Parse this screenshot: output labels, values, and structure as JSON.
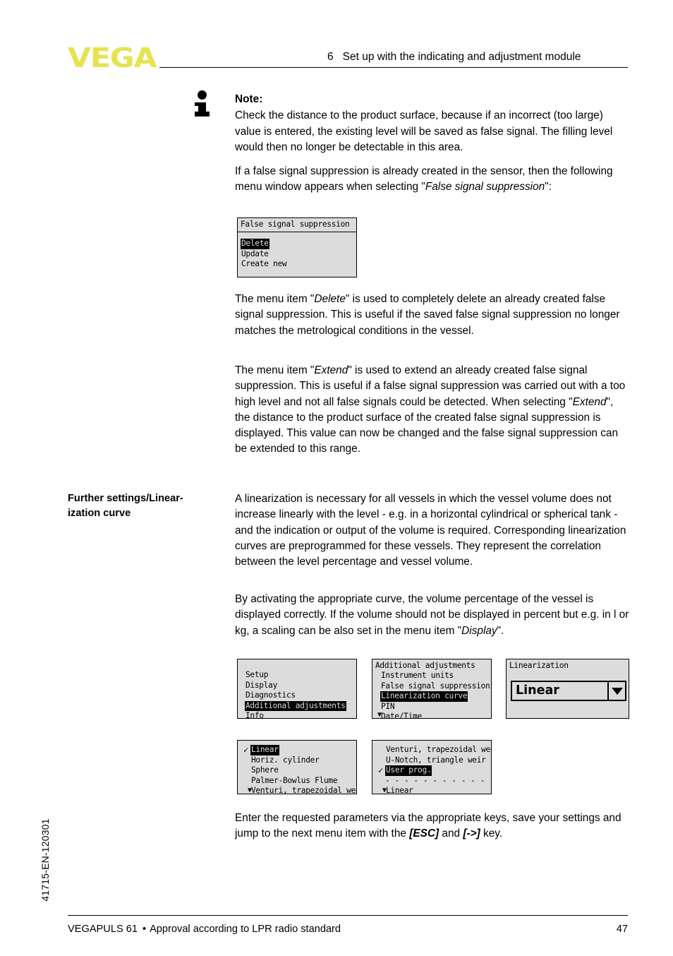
{
  "header": {
    "logo_text": "VEGA",
    "logo_color": "#e6e352",
    "chapter_number": "6",
    "chapter_title": "Set up with the indicating and adjustment module"
  },
  "doc_id": "41715-EN-120301",
  "note": {
    "icon": "info-icon",
    "title": "Note:",
    "text": "Check the distance to the product surface, because if an incorrect (too large) value is entered, the existing level will be saved as false signal. The filling level would then no longer be detectable in this area."
  },
  "paragraphs": {
    "intro_1": "If a false signal suppression is already created in the sensor, then the following menu window appears when selecting \"",
    "intro_1_em": "False signal suppression",
    "intro_1_end": "\":",
    "delete_p_1": "The menu item \"",
    "delete_p_em": "Delete",
    "delete_p_2": "\" is used to completely delete an already created false signal suppression. This is useful if the saved false signal suppression no longer matches the metrological conditions in the vessel.",
    "extend_p_1": "The menu item \"",
    "extend_p_em1": "Extend",
    "extend_p_2": "\" is used to extend an already created false signal suppression. This is useful if a false signal suppression was carried out with a too high level and not all false signals could be detected. When selecting \"",
    "extend_p_em2": "Extend",
    "extend_p_3": "\", the distance to the product surface of the created false signal suppression is displayed. This value can now be changed and the false signal suppression can be extended to this range.",
    "lin_intro": "A linearization is necessary for all vessels in which the vessel volume does not increase linearly with the level - e.g. in a horizontal cylindrical or spherical tank - and the indication or output of the volume is required. Corresponding linearization curves are preprogrammed for these vessels. They represent the correlation between the level percentage and vessel volume.",
    "lin_activate_1": "By activating the appropriate curve, the volume percentage of the vessel is displayed correctly. If the volume should not be displayed in percent but e.g. in l or kg, a scaling can be also set in the menu item \"",
    "lin_activate_em": "Display",
    "lin_activate_2": "\".",
    "closing_1": "Enter the requested parameters via the appropriate keys, save your settings and jump to the next menu item with the ",
    "closing_key1": "[ESC]",
    "closing_mid": " and ",
    "closing_key2": "[->]",
    "closing_2": " key."
  },
  "margin_heading": "Further settings/Linear-\nization curve",
  "lcd_screens": {
    "false_signal": {
      "title": "False signal suppression",
      "items": [
        {
          "label": "Delete",
          "selected": true
        },
        {
          "label": "Update",
          "selected": false
        },
        {
          "label": "Create new",
          "selected": false
        }
      ]
    },
    "main_menu": {
      "items": [
        {
          "label": "Setup",
          "selected": false
        },
        {
          "label": "Display",
          "selected": false
        },
        {
          "label": "Diagnostics",
          "selected": false
        },
        {
          "label": "Additional adjustments",
          "selected": true
        },
        {
          "label": "Info",
          "selected": false
        }
      ]
    },
    "additional_adjustments": {
      "title": "Additional adjustments",
      "items": [
        {
          "label": "Instrument units",
          "selected": false
        },
        {
          "label": "False signal suppression",
          "selected": false
        },
        {
          "label": "Linearization curve",
          "selected": true
        },
        {
          "label": "PIN",
          "selected": false
        },
        {
          "label": "Date/Time",
          "selected": false
        }
      ],
      "more_indicator": "▼"
    },
    "linearization": {
      "title": "Linearization",
      "selected_value": "Linear",
      "caret": "▼"
    },
    "curve_list_1": {
      "items": [
        {
          "label": "Linear",
          "selected": true,
          "checked": true
        },
        {
          "label": "Horiz. cylinder",
          "selected": false,
          "checked": false
        },
        {
          "label": "Sphere",
          "selected": false,
          "checked": false
        },
        {
          "label": "Palmer-Bowlus Flume",
          "selected": false,
          "checked": false
        },
        {
          "label": "Venturi, trapezoidal weir",
          "selected": false,
          "checked": false
        }
      ],
      "more_indicator": "▼",
      "check_glyph": "✓"
    },
    "curve_list_2": {
      "items": [
        {
          "label": "Venturi, trapezoidal weir",
          "selected": false,
          "checked": false
        },
        {
          "label": "U-Notch, triangle weir",
          "selected": false,
          "checked": false
        },
        {
          "label": "User prog.",
          "selected": true,
          "checked": true
        }
      ],
      "separator": "- - - - - - - - - - - - - - - - - - - -",
      "trailing_item": "Linear",
      "more_indicator": "▼",
      "check_glyph": "✓"
    }
  },
  "footer": {
    "product": "VEGAPULS 61",
    "bullet": "•",
    "subtitle": "Approval according to LPR radio standard",
    "page_number": "47"
  }
}
